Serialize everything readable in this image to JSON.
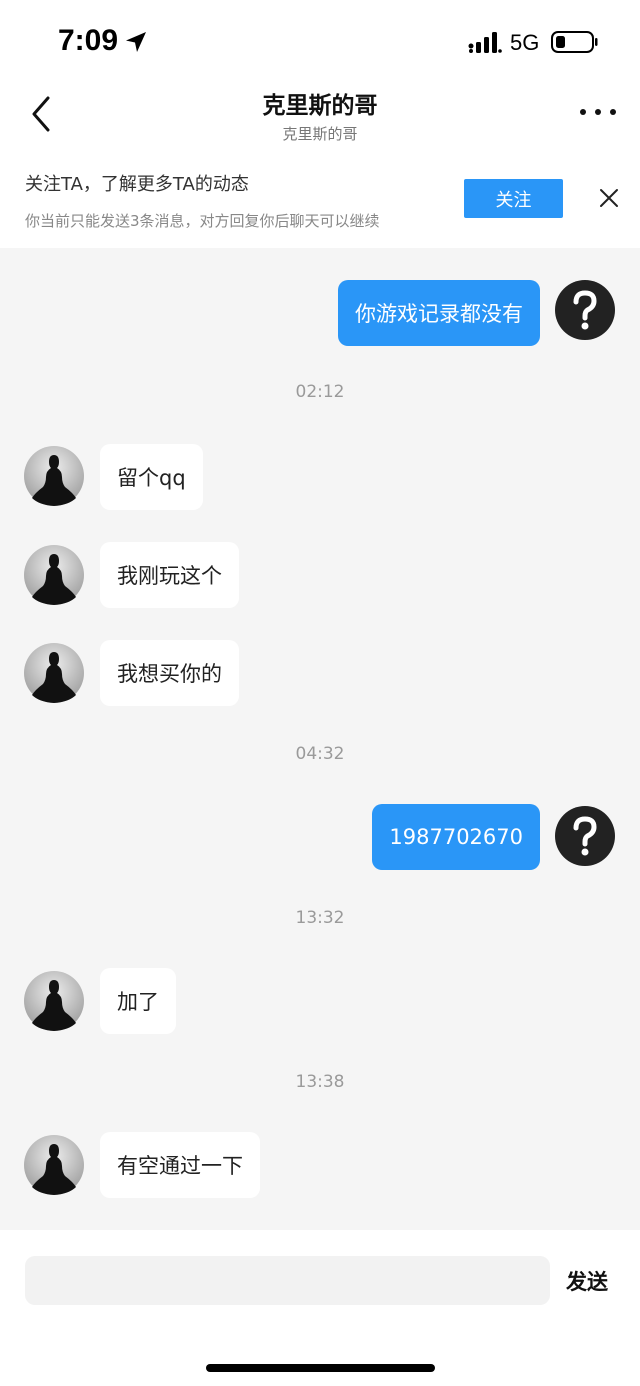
{
  "status_bar": {
    "time": "7:09",
    "network": "5G",
    "icons": [
      "location-arrow-icon",
      "signal-icon",
      "battery-icon"
    ]
  },
  "nav": {
    "title": "克里斯的哥",
    "subtitle": "克里斯的哥",
    "icons": [
      "back-chevron-icon",
      "more-icon"
    ]
  },
  "follow_banner": {
    "title": "关注TA，了解更多TA的动态",
    "subtitle": "你当前只能发送3条消息，对方回复你后聊天可以继续",
    "follow_label": "关注",
    "close_icon": "close-icon"
  },
  "chat": {
    "messages": [
      {
        "direction": "out",
        "text": "你游戏记录都没有"
      },
      {
        "timestamp": "02:12"
      },
      {
        "direction": "in",
        "text": "留个qq"
      },
      {
        "direction": "in",
        "text": "我刚玩这个"
      },
      {
        "direction": "in",
        "text": "我想买你的"
      },
      {
        "timestamp": "04:32"
      },
      {
        "direction": "out",
        "text": "1987702670"
      },
      {
        "timestamp": "13:32"
      },
      {
        "direction": "in",
        "text": "加了"
      },
      {
        "timestamp": "13:38"
      },
      {
        "direction": "in",
        "text": "有空通过一下"
      }
    ]
  },
  "input_bar": {
    "placeholder": "",
    "send_label": "发送"
  },
  "colors": {
    "accent": "#2a96f7",
    "background": "#f5f5f5",
    "bubble_in": "#ffffff",
    "timestamp": "#9a9a9a"
  }
}
